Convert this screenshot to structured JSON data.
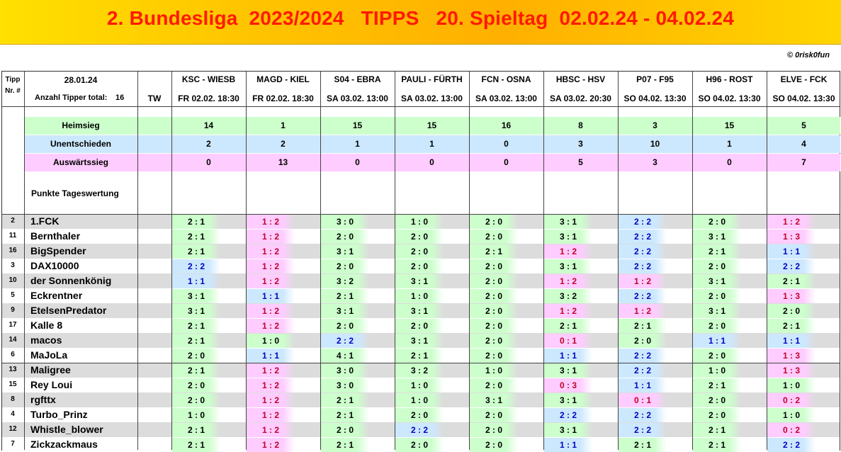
{
  "title": "2. Bundesliga  2023/2024   TIPPS   20. Spieltag  02.02.24 - 04.02.24",
  "copyright": "© 0risk0fun",
  "header": {
    "tipp_nr": [
      "Tipp",
      "Nr. #"
    ],
    "date": "28.01.24",
    "total_label": "Anzahl Tipper total:",
    "total_value": "16",
    "tw": "TW"
  },
  "matches": [
    {
      "teams": "KSC - WIESB",
      "kickoff": "FR 02.02. 18:30"
    },
    {
      "teams": "MAGD - KIEL",
      "kickoff": "FR 02.02. 18:30"
    },
    {
      "teams": "S04 - EBRA",
      "kickoff": "SA 03.02. 13:00"
    },
    {
      "teams": "PAULI - FÜRTH",
      "kickoff": "SA 03.02. 13:00"
    },
    {
      "teams": "FCN - OSNA",
      "kickoff": "SA 03.02. 13:00"
    },
    {
      "teams": "HBSC - HSV",
      "kickoff": "SA 03.02. 20:30"
    },
    {
      "teams": "P07 - F95",
      "kickoff": "SO 04.02. 13:30"
    },
    {
      "teams": "H96 - ROST",
      "kickoff": "SO 04.02. 13:30"
    },
    {
      "teams": "ELVE - FCK",
      "kickoff": "SO 04.02. 13:30"
    }
  ],
  "summary": [
    {
      "label": "Heimsieg",
      "values": [
        "14",
        "1",
        "15",
        "15",
        "16",
        "8",
        "3",
        "15",
        "5"
      ]
    },
    {
      "label": "Unentschieden",
      "values": [
        "2",
        "2",
        "1",
        "1",
        "0",
        "3",
        "10",
        "1",
        "4"
      ]
    },
    {
      "label": "Auswärtssieg",
      "values": [
        "0",
        "13",
        "0",
        "0",
        "0",
        "5",
        "3",
        "0",
        "7"
      ]
    }
  ],
  "punkte_label": "Punkte Tageswertung",
  "colors": {
    "home": "#ccffcc",
    "draw": "#cce8ff",
    "away": "#ffccff",
    "banner_text": "#ff1a00"
  },
  "players": [
    {
      "nr": "2",
      "name": "1.FCK",
      "tips": [
        "2 : 1",
        "1 : 2",
        "3 : 0",
        "1 : 0",
        "2 : 0",
        "3 : 1",
        "2 : 2",
        "2 : 0",
        "1 : 2"
      ]
    },
    {
      "nr": "11",
      "name": "Bernthaler",
      "tips": [
        "2 : 1",
        "1 : 2",
        "2 : 0",
        "2 : 0",
        "2 : 0",
        "3 : 1",
        "2 : 2",
        "3 : 1",
        "1 : 3"
      ]
    },
    {
      "nr": "16",
      "name": "BigSpender",
      "tips": [
        "2 : 1",
        "1 : 2",
        "3 : 1",
        "2 : 0",
        "2 : 1",
        "1 : 2",
        "2 : 2",
        "2 : 1",
        "1 : 1"
      ]
    },
    {
      "nr": "3",
      "name": "DAX10000",
      "tips": [
        "2 : 2",
        "1 : 2",
        "2 : 0",
        "2 : 0",
        "2 : 0",
        "3 : 1",
        "2 : 2",
        "2 : 0",
        "2 : 2"
      ]
    },
    {
      "nr": "10",
      "name": "der Sonnenkönig",
      "tips": [
        "1 : 1",
        "1 : 2",
        "3 : 2",
        "3 : 1",
        "2 : 0",
        "1 : 2",
        "1 : 2",
        "3 : 1",
        "2 : 1"
      ]
    },
    {
      "nr": "5",
      "name": "Eckrentner",
      "tips": [
        "3 : 1",
        "1 : 1",
        "2 : 1",
        "1 : 0",
        "2 : 0",
        "3 : 2",
        "2 : 2",
        "2 : 0",
        "1 : 3"
      ]
    },
    {
      "nr": "9",
      "name": "EtelsenPredator",
      "tips": [
        "3 : 1",
        "1 : 2",
        "3 : 1",
        "3 : 1",
        "2 : 0",
        "1 : 2",
        "1 : 2",
        "3 : 1",
        "2 : 0"
      ]
    },
    {
      "nr": "17",
      "name": "Kalle 8",
      "tips": [
        "2 : 1",
        "1 : 2",
        "2 : 0",
        "2 : 0",
        "2 : 0",
        "2 : 1",
        "2 : 1",
        "2 : 0",
        "2 : 1"
      ]
    },
    {
      "nr": "14",
      "name": "macos",
      "tips": [
        "2 : 1",
        "1 : 0",
        "2 : 2",
        "3 : 1",
        "2 : 0",
        "0 : 1",
        "2 : 0",
        "1 : 1",
        "1 : 1"
      ]
    },
    {
      "nr": "6",
      "name": "MaJoLa",
      "tips": [
        "2 : 0",
        "1 : 1",
        "4 : 1",
        "2 : 1",
        "2 : 0",
        "1 : 1",
        "2 : 2",
        "2 : 0",
        "1 : 3"
      ]
    },
    {
      "nr": "13",
      "name": "Maligree",
      "tips": [
        "2 : 1",
        "1 : 2",
        "3 : 0",
        "3 : 2",
        "1 : 0",
        "3 : 1",
        "2 : 2",
        "1 : 0",
        "1 : 3"
      ]
    },
    {
      "nr": "15",
      "name": "Rey Loui",
      "tips": [
        "2 : 0",
        "1 : 2",
        "3 : 0",
        "1 : 0",
        "2 : 0",
        "0 : 3",
        "1 : 1",
        "2 : 1",
        "1 : 0"
      ]
    },
    {
      "nr": "8",
      "name": "rgfttx",
      "tips": [
        "2 : 0",
        "1 : 2",
        "2 : 1",
        "1 : 0",
        "3 : 1",
        "3 : 1",
        "0 : 1",
        "2 : 0",
        "0 : 2"
      ]
    },
    {
      "nr": "4",
      "name": "Turbo_Prinz",
      "tips": [
        "1 : 0",
        "1 : 2",
        "2 : 1",
        "2 : 0",
        "2 : 0",
        "2 : 2",
        "2 : 2",
        "2 : 0",
        "1 : 0"
      ]
    },
    {
      "nr": "12",
      "name": "Whistle_blower",
      "tips": [
        "2 : 1",
        "1 : 2",
        "2 : 0",
        "2 : 2",
        "2 : 0",
        "3 : 1",
        "2 : 2",
        "2 : 1",
        "0 : 2"
      ]
    },
    {
      "nr": "7",
      "name": "Zickzackmaus",
      "tips": [
        "2 : 1",
        "1 : 2",
        "2 : 1",
        "2 : 0",
        "2 : 0",
        "1 : 1",
        "2 : 1",
        "2 : 1",
        "2 : 2"
      ]
    }
  ]
}
